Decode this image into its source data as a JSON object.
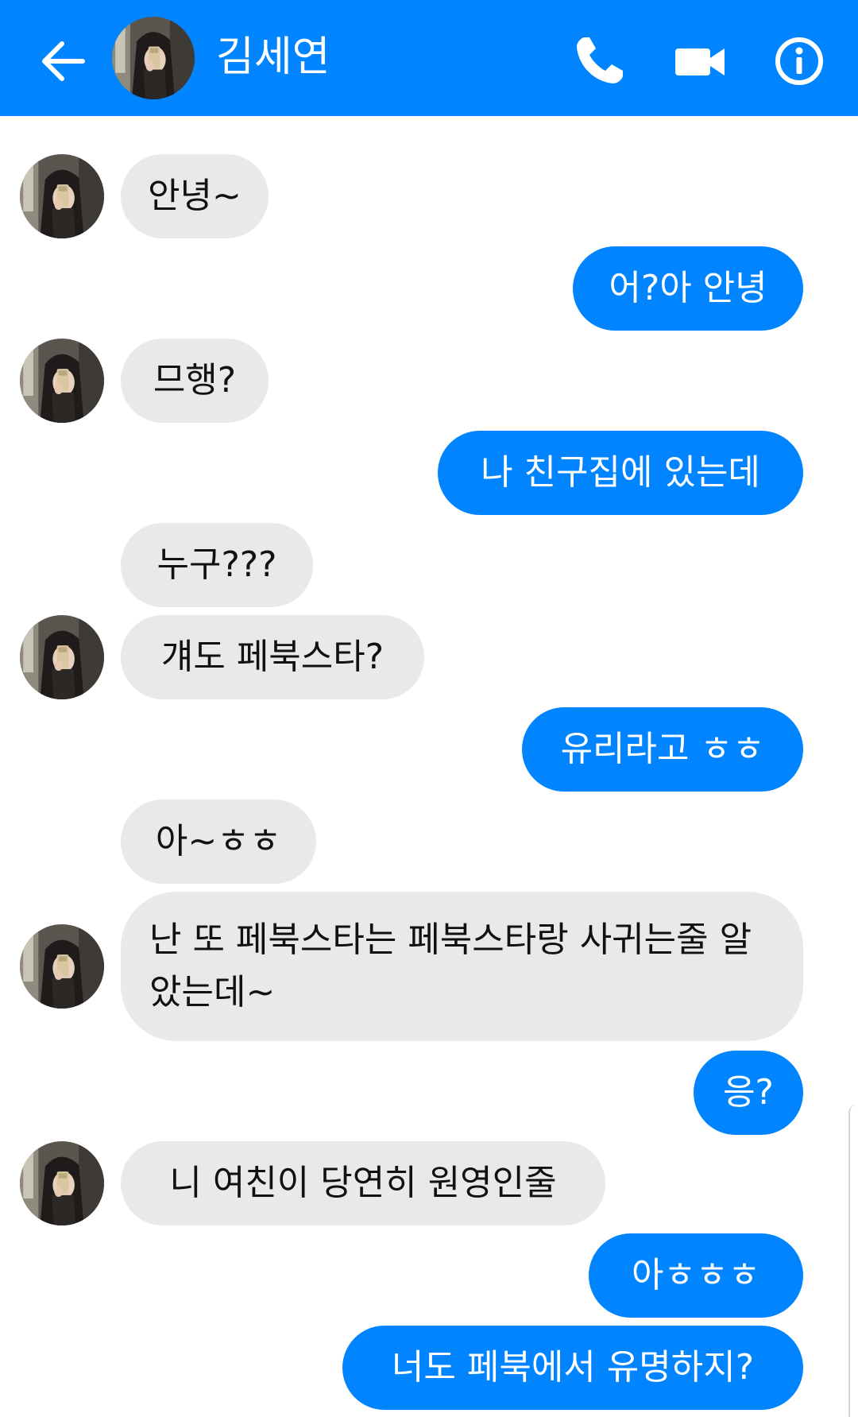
{
  "header": {
    "contact_name": "김세연",
    "background": "#0084ff",
    "icons": [
      "back-arrow-icon",
      "phone-icon",
      "video-camera-icon",
      "info-icon"
    ]
  },
  "colors": {
    "outgoing_bubble": "#0084ff",
    "incoming_bubble": "#e9e9e9",
    "outgoing_text": "#ffffff",
    "incoming_text": "#111111"
  },
  "messages": [
    {
      "sender": "them",
      "text": "안녕~"
    },
    {
      "sender": "me",
      "text": "어?아 안녕"
    },
    {
      "sender": "them",
      "text": "므행?"
    },
    {
      "sender": "me",
      "text": "나 친구집에 있는데"
    },
    {
      "sender": "them",
      "text": "누구???"
    },
    {
      "sender": "them",
      "text": "걔도 페북스타?"
    },
    {
      "sender": "me",
      "text": "유리라고 ㅎㅎ"
    },
    {
      "sender": "them",
      "text": "아~ㅎㅎ"
    },
    {
      "sender": "them",
      "text": "난 또 페북스타는 페북스타랑 사귀는줄 알았는데~"
    },
    {
      "sender": "me",
      "text": "응?"
    },
    {
      "sender": "them",
      "text": "니 여친이 당연히 원영인줄"
    },
    {
      "sender": "me",
      "text": "아ㅎㅎㅎ"
    },
    {
      "sender": "me",
      "text": "너도 페북에서 유명하지?"
    }
  ]
}
